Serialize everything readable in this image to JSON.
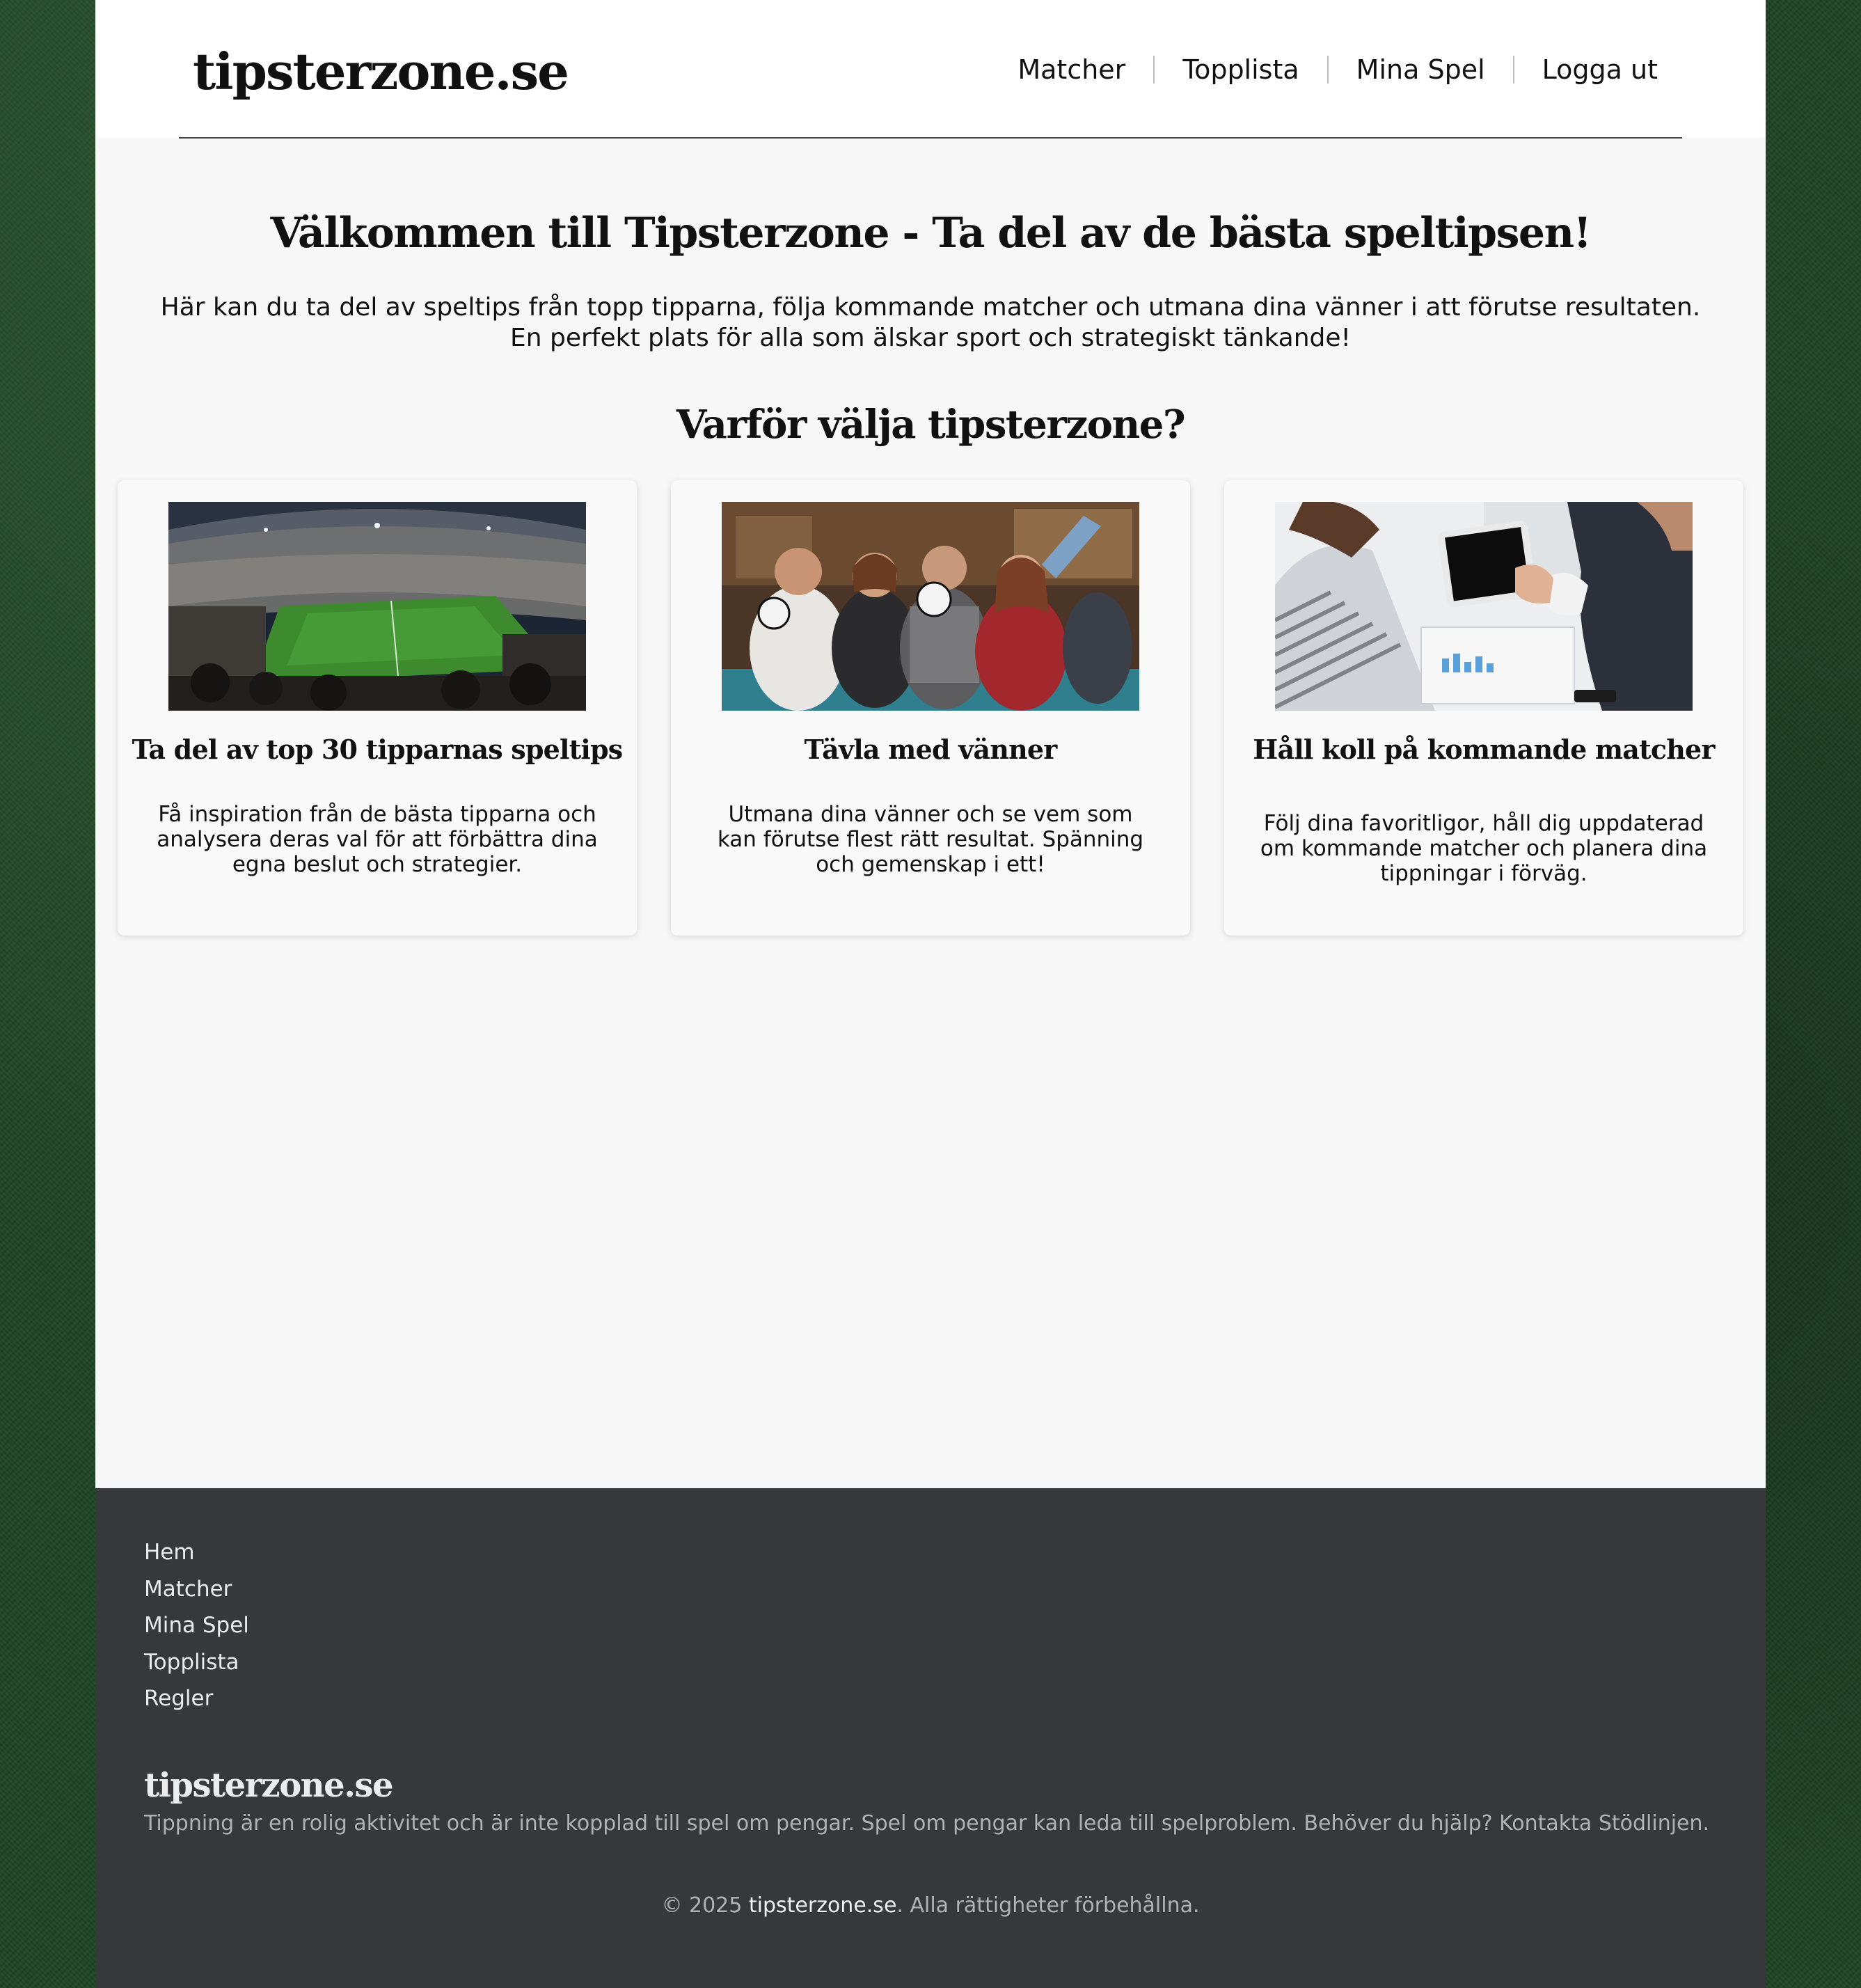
{
  "site": {
    "logo": "tipsterzone.se"
  },
  "nav": {
    "items": [
      {
        "label": "Matcher"
      },
      {
        "label": "Topplista"
      },
      {
        "label": "Mina Spel"
      },
      {
        "label": "Logga ut"
      }
    ]
  },
  "hero": {
    "title": "Välkommen till Tipsterzone - Ta del av de bästa speltipsen!",
    "text": "Här kan du ta del av speltips från topp tipparna, följa kommande matcher och utmana dina vänner i att förutse resultaten. En perfekt plats för alla som älskar sport och strategiskt tänkande!"
  },
  "features": {
    "title": "Varför välja tipsterzone?",
    "cards": [
      {
        "image": "stadium-photo",
        "title": "Ta del av top 30 tipparnas speltips",
        "text": "Få inspiration från de bästa tipparna och analysera deras val för att förbättra dina egna beslut och strategier."
      },
      {
        "image": "friends-cheering-photo",
        "title": "Tävla med vänner",
        "text": "Utmana dina vänner och se vem som kan förutse flest rätt resultat. Spänning och gemenskap i ett!"
      },
      {
        "image": "tablet-meeting-photo",
        "title": "Håll koll på kommande matcher",
        "text": "Följ dina favoritligor, håll dig uppdaterad om kommande matcher och planera dina tippningar i förväg."
      }
    ]
  },
  "footer": {
    "links": [
      {
        "label": "Hem"
      },
      {
        "label": "Matcher"
      },
      {
        "label": "Mina Spel"
      },
      {
        "label": "Topplista"
      },
      {
        "label": "Regler"
      }
    ],
    "logo": "tipsterzone.se",
    "disclaimer": "Tippning är en rolig aktivitet och är inte kopplad till spel om pengar. Spel om pengar kan leda till spelproblem. Behöver du hjälp? Kontakta Stödlinjen.",
    "copyright_prefix": "© 2025 ",
    "copyright_brand": "tipsterzone.se",
    "copyright_suffix": ". Alla rättigheter förbehållna."
  },
  "colors": {
    "background": "#1f4424",
    "page": "#f7f7f7",
    "header": "#ffffff",
    "footer": "#37383a",
    "text": "#111111",
    "footer_text": "#ececec",
    "footer_muted": "#b2b2b2"
  }
}
